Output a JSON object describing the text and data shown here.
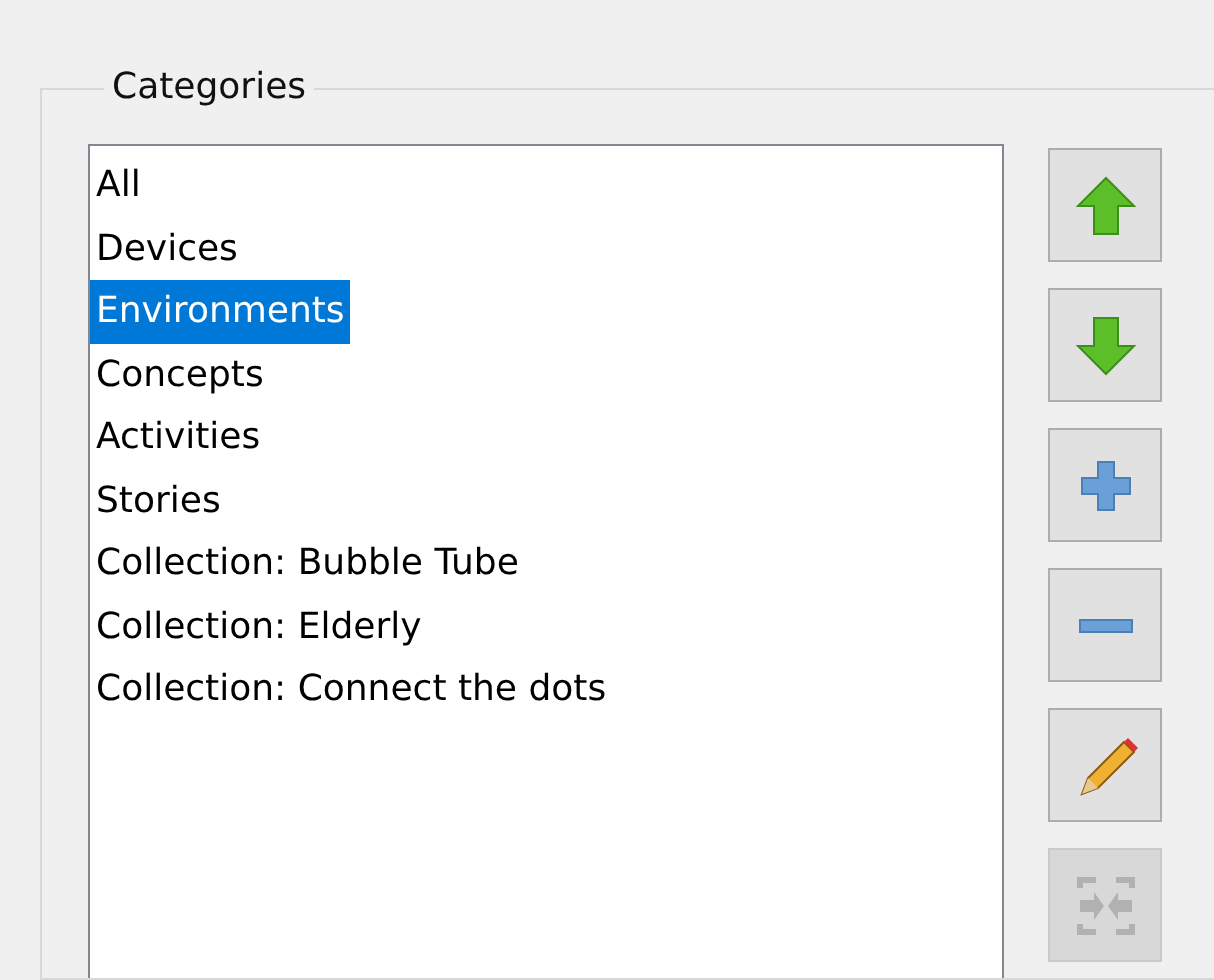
{
  "group": {
    "title": "Categories"
  },
  "categories": [
    {
      "label": "All",
      "selected": false
    },
    {
      "label": "Devices",
      "selected": false
    },
    {
      "label": "Environments",
      "selected": true
    },
    {
      "label": "Concepts",
      "selected": false
    },
    {
      "label": "Activities",
      "selected": false
    },
    {
      "label": "Stories",
      "selected": false
    },
    {
      "label": "Collection: Bubble Tube",
      "selected": false
    },
    {
      "label": "Collection: Elderly",
      "selected": false
    },
    {
      "label": "Collection: Connect the dots",
      "selected": false
    }
  ],
  "buttons": [
    {
      "kind": "up",
      "disabled": false
    },
    {
      "kind": "down",
      "disabled": false
    },
    {
      "kind": "add",
      "disabled": false
    },
    {
      "kind": "remove",
      "disabled": false
    },
    {
      "kind": "edit",
      "disabled": false
    },
    {
      "kind": "merge",
      "disabled": true
    }
  ]
}
